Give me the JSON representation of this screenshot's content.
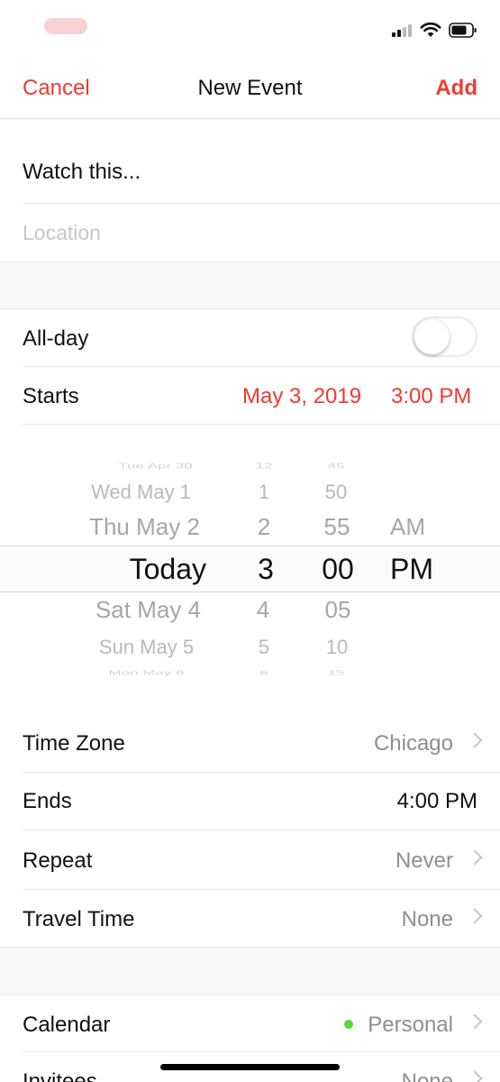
{
  "nav": {
    "cancel_label": "Cancel",
    "title": "New Event",
    "add_label": "Add"
  },
  "event": {
    "title_value": "Watch this...",
    "location_placeholder": "Location"
  },
  "all_day": {
    "label": "All-day",
    "enabled": false
  },
  "starts": {
    "label": "Starts",
    "date": "May 3, 2019",
    "time": "3:00 PM"
  },
  "picker": {
    "days": [
      "Tue Apr 30",
      "Wed May 1",
      "Thu May 2",
      "Today",
      "Sat May 4",
      "Sun May 5",
      "Mon May 6"
    ],
    "hours": [
      "12",
      "1",
      "2",
      "3",
      "4",
      "5",
      "6"
    ],
    "minutes": [
      "45",
      "50",
      "55",
      "00",
      "05",
      "10",
      "15"
    ],
    "meridiem": [
      "AM",
      "PM"
    ]
  },
  "time_zone": {
    "label": "Time Zone",
    "value": "Chicago"
  },
  "ends": {
    "label": "Ends",
    "value": "4:00 PM"
  },
  "repeat": {
    "label": "Repeat",
    "value": "Never"
  },
  "travel_time": {
    "label": "Travel Time",
    "value": "None"
  },
  "calendar": {
    "label": "Calendar",
    "value": "Personal",
    "dot_color": "#5ad63b"
  },
  "invitees": {
    "label": "Invitees",
    "value": "None"
  },
  "colors": {
    "accent": "#f03a2f",
    "secondary_text": "#8e8e93"
  }
}
